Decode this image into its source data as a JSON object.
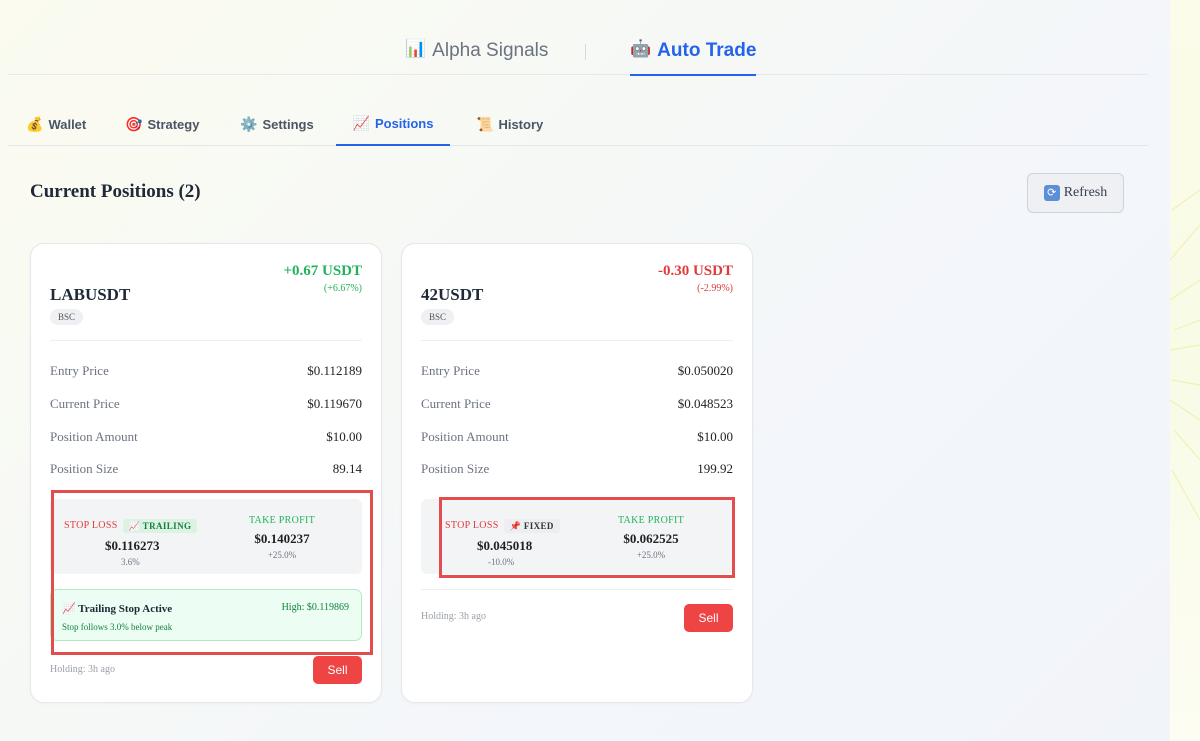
{
  "top_tabs": [
    {
      "icon": "📊",
      "icon_name": "bar-chart-icon",
      "label": "Alpha Signals",
      "active": false
    },
    {
      "icon": "🤖",
      "icon_name": "robot-icon",
      "label": "Auto Trade",
      "active": true
    }
  ],
  "sub_tabs": [
    {
      "icon": "💰",
      "icon_name": "money-bag-icon",
      "label": "Wallet",
      "active": false
    },
    {
      "icon": "🎯",
      "icon_name": "target-icon",
      "label": "Strategy",
      "active": false
    },
    {
      "icon": "⚙️",
      "icon_name": "gear-icon",
      "label": "Settings",
      "active": false
    },
    {
      "icon": "📈",
      "icon_name": "chart-up-icon",
      "label": "Positions",
      "active": true
    },
    {
      "icon": "📜",
      "icon_name": "scroll-icon",
      "label": "History",
      "active": false
    }
  ],
  "section": {
    "title": "Current Positions (2)",
    "refresh_label": "Refresh",
    "refresh_icon": "🔄"
  },
  "positions": [
    {
      "symbol": "LABUSDT",
      "chain": "BSC",
      "pnl_value": "+0.67 USDT",
      "pnl_pct": "(+6.67%)",
      "pnl_positive": true,
      "rows": [
        {
          "key": "Entry Price",
          "value": "$0.112189"
        },
        {
          "key": "Current Price",
          "value": "$0.119670"
        },
        {
          "key": "Position Amount",
          "value": "$10.00"
        },
        {
          "key": "Position Size",
          "value": "89.14"
        }
      ],
      "stop_loss": {
        "label": "STOP LOSS",
        "mode_icon": "📈",
        "mode": "TRAILING",
        "price": "$0.116273",
        "sub": "3.6%"
      },
      "take_profit": {
        "label": "TAKE PROFIT",
        "price": "$0.140237",
        "sub": "+25.0%"
      },
      "trailing": {
        "icon": "📈",
        "title": "Trailing Stop Active",
        "high": "High: $0.119869",
        "desc": "Stop follows 3.0% below peak"
      },
      "holding": "Holding: 3h ago",
      "sell_label": "Sell"
    },
    {
      "symbol": "42USDT",
      "chain": "BSC",
      "pnl_value": "-0.30 USDT",
      "pnl_pct": "(-2.99%)",
      "pnl_positive": false,
      "rows": [
        {
          "key": "Entry Price",
          "value": "$0.050020"
        },
        {
          "key": "Current Price",
          "value": "$0.048523"
        },
        {
          "key": "Position Amount",
          "value": "$10.00"
        },
        {
          "key": "Position Size",
          "value": "199.92"
        }
      ],
      "stop_loss": {
        "label": "STOP LOSS",
        "mode_icon": "📌",
        "mode": "FIXED",
        "price": "$0.045018",
        "sub": "-10.0%"
      },
      "take_profit": {
        "label": "TAKE PROFIT",
        "price": "$0.062525",
        "sub": "+25.0%"
      },
      "holding": "Holding: 3h ago",
      "sell_label": "Sell"
    }
  ],
  "colors": {
    "accent": "#2563eb",
    "positive": "#22b35a",
    "negative": "#e03b3b",
    "sell": "#ef4444",
    "highlight_box": "#e44d4d"
  }
}
